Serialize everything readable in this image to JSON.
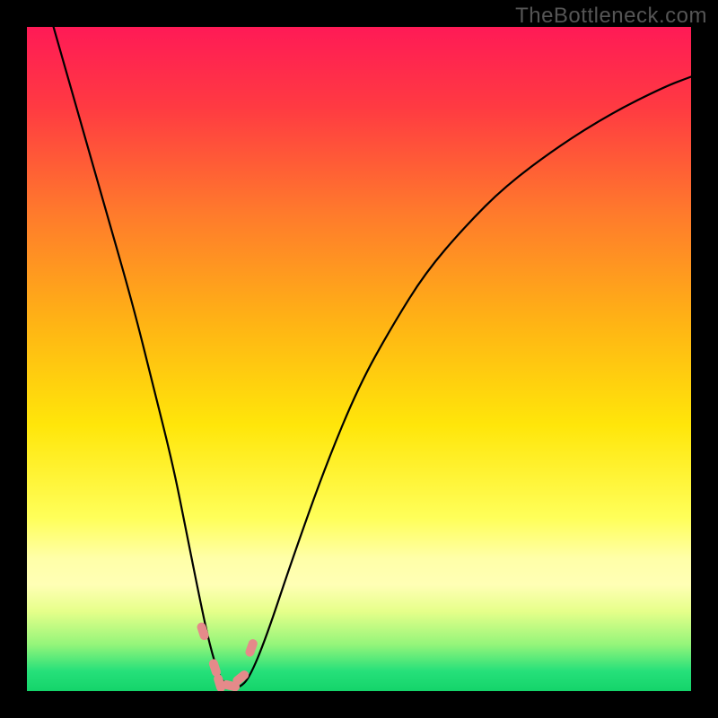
{
  "watermark": "TheBottleneck.com",
  "chart_data": {
    "type": "line",
    "title": "",
    "xlabel": "",
    "ylabel": "",
    "xlim": [
      0,
      100
    ],
    "ylim": [
      0,
      100
    ],
    "background_gradient": {
      "stops": [
        {
          "offset": 0.0,
          "color": "#ff1a56"
        },
        {
          "offset": 0.12,
          "color": "#ff3a42"
        },
        {
          "offset": 0.28,
          "color": "#ff7a2c"
        },
        {
          "offset": 0.45,
          "color": "#ffb514"
        },
        {
          "offset": 0.6,
          "color": "#ffe60a"
        },
        {
          "offset": 0.74,
          "color": "#ffff5a"
        },
        {
          "offset": 0.8,
          "color": "#ffffa8"
        },
        {
          "offset": 0.84,
          "color": "#ffffb5"
        },
        {
          "offset": 0.88,
          "color": "#e6ff8a"
        },
        {
          "offset": 0.93,
          "color": "#94f57a"
        },
        {
          "offset": 0.97,
          "color": "#26e07a"
        },
        {
          "offset": 1.0,
          "color": "#14d46a"
        }
      ]
    },
    "series": [
      {
        "name": "bottleneck-curve",
        "type": "line",
        "color": "#000000",
        "x": [
          4,
          8,
          12,
          16,
          19,
          22,
          24,
          26,
          27.5,
          29,
          30.5,
          32,
          33.5,
          36,
          40,
          45,
          50,
          55,
          60,
          66,
          72,
          80,
          88,
          96,
          100
        ],
        "y": [
          100,
          86,
          72,
          58,
          46,
          34,
          24,
          14,
          7,
          2,
          0.5,
          0.5,
          2,
          8,
          20,
          34,
          46,
          55,
          63,
          70,
          76,
          82,
          87,
          91,
          92.5
        ]
      },
      {
        "name": "dip-highlight-pills",
        "type": "scatter",
        "color": "#e58a8a",
        "x": [
          26.5,
          28.3,
          29.0,
          30.7,
          32.2,
          33.8
        ],
        "y": [
          9,
          3.5,
          1.2,
          0.8,
          2.0,
          6.5
        ]
      }
    ]
  }
}
